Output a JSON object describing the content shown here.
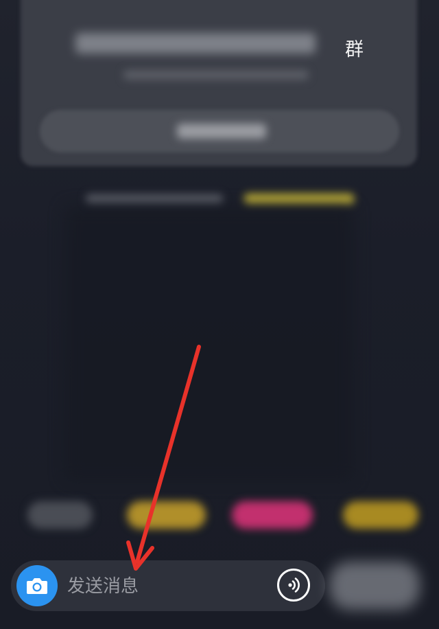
{
  "card": {
    "title": "群"
  },
  "input_bar": {
    "placeholder": "发送消息"
  },
  "icons": {
    "camera": "camera-icon",
    "voice": "voice-icon"
  },
  "colors": {
    "background": "#1a1d28",
    "camera_button": "#2b93f0",
    "input_bar": "#2e313b",
    "arrow": "#e8322a"
  }
}
